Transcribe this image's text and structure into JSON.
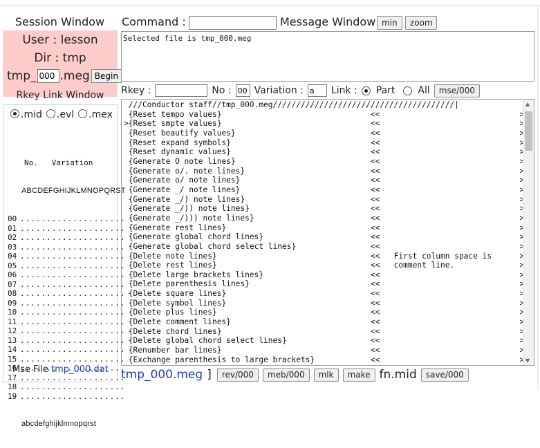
{
  "session": {
    "title": "Session Window",
    "user": "User : lesson",
    "dir": "Dir : tmp",
    "tmp_prefix": "tmp_",
    "tmp_value": "000",
    "tmp_suffix": ".meg",
    "begin_label": "Begin"
  },
  "rkey_link": {
    "title": "Rkey Link Window",
    "options": [
      {
        "label": ".mid",
        "selected": true
      },
      {
        "label": ".evl",
        "selected": false
      },
      {
        "label": ".mex",
        "selected": false
      }
    ],
    "header_no": "No.",
    "header_variation": "Variation",
    "upper_letters": "ABCDEFGHIJKLMNOPQRST",
    "lower_letters": "abcdefghijklmnopqrst",
    "rows": [
      {
        "num": "00",
        "dots": "...................."
      },
      {
        "num": "01",
        "dots": "...................."
      },
      {
        "num": "02",
        "dots": "...................."
      },
      {
        "num": "03",
        "dots": "...................."
      },
      {
        "num": "04",
        "dots": "...................."
      },
      {
        "num": "05",
        "dots": "...................."
      },
      {
        "num": "06",
        "dots": "...................."
      },
      {
        "num": "07",
        "dots": "...................."
      },
      {
        "num": "08",
        "dots": "...................."
      },
      {
        "num": "09",
        "dots": "...................."
      },
      {
        "num": "10",
        "dots": "...................."
      },
      {
        "num": "11",
        "dots": "...................."
      },
      {
        "num": "12",
        "dots": "...................."
      },
      {
        "num": "13",
        "dots": "...................."
      },
      {
        "num": "14",
        "dots": "...................."
      },
      {
        "num": "15",
        "dots": "...................."
      },
      {
        "num": "16",
        "dots": "...................."
      },
      {
        "num": "17",
        "dots": "...................."
      },
      {
        "num": "18",
        "dots": "...................."
      },
      {
        "num": "19",
        "dots": "...................."
      }
    ],
    "mse_label": "Mse File",
    "mse_file": "tmp_000.dat"
  },
  "command": {
    "label": "Command :",
    "value": "",
    "message_label": "Message Window",
    "min_label": "min",
    "zoom_label": "zoom",
    "message_text": "Selected file is tmp_000.meg"
  },
  "rkey_row": {
    "rkey_label": "Rkey :",
    "rkey_value": "",
    "no_label": "No :",
    "no_value": "00",
    "variation_label": "Variation :",
    "variation_value": "a",
    "link_label": "Link :",
    "part_label": "Part",
    "part_selected": true,
    "all_label": "All",
    "all_selected": false,
    "mse_button": "mse/000"
  },
  "editor": {
    "lines": [
      " ///Conductor staff//tmp_000.meg///////////////////////////////////////|",
      " {Reset tempo values}                                <<                              >>",
      ">{Reset smpte values}                                <<                              >>",
      " {Reset beautify values}                             <<                              >>",
      " {Reset expand symbols}                              <<                              >>",
      " {Reset dynamic values}                              <<                              >>",
      " {Generate O note lines}                             <<                              >>",
      " {Generate o/. note lines}                           <<                              >>",
      " {Generate o/ note lines}                            <<                              >>",
      " {Generate _/ note lines}                            <<                              >>",
      " {Generate _/) note lines}                           <<                              >>",
      " {Generate _/)) note lines}                          <<                              >>",
      " {Generate _/))) note lines}                         <<                              >>",
      " {Generate rest lines}                               <<                              >>",
      " {Generate global chord lines}                       <<                              >>",
      " {Generate global chord select lines}                <<                              >>",
      " {Delete note lines}                                 <<   First column space is      >>",
      " {Delete rest lines}                                 <<   comment line.              >>",
      " {Delete large brackets lines}                       <<                              >>",
      " {Delete parenthesis lines}                          <<                              >>",
      " {Delete square lines}                               <<                              >>",
      " {Delete symbol lines}                               <<                              >>",
      " {Delete plus lines}                                 <<                              >>",
      " {Delete comment lines}                              <<                              >>",
      " {Delete chord lines}                                <<                              >>",
      " {Delete global chord select lines}                  <<                              >>",
      " {Renumber bar lines}                                <<                              >>",
      " {Exchange parenthesis to large brackets}            <<                              >>"
    ]
  },
  "bottom": {
    "file_name": "tmp_000.meg",
    "bracket": "]",
    "rev_button": "rev/000",
    "meb_button": "meb/000",
    "mlk_button": "mlk",
    "make_button": "make",
    "fn_label": "fn.mid",
    "save_button": "save/000"
  }
}
